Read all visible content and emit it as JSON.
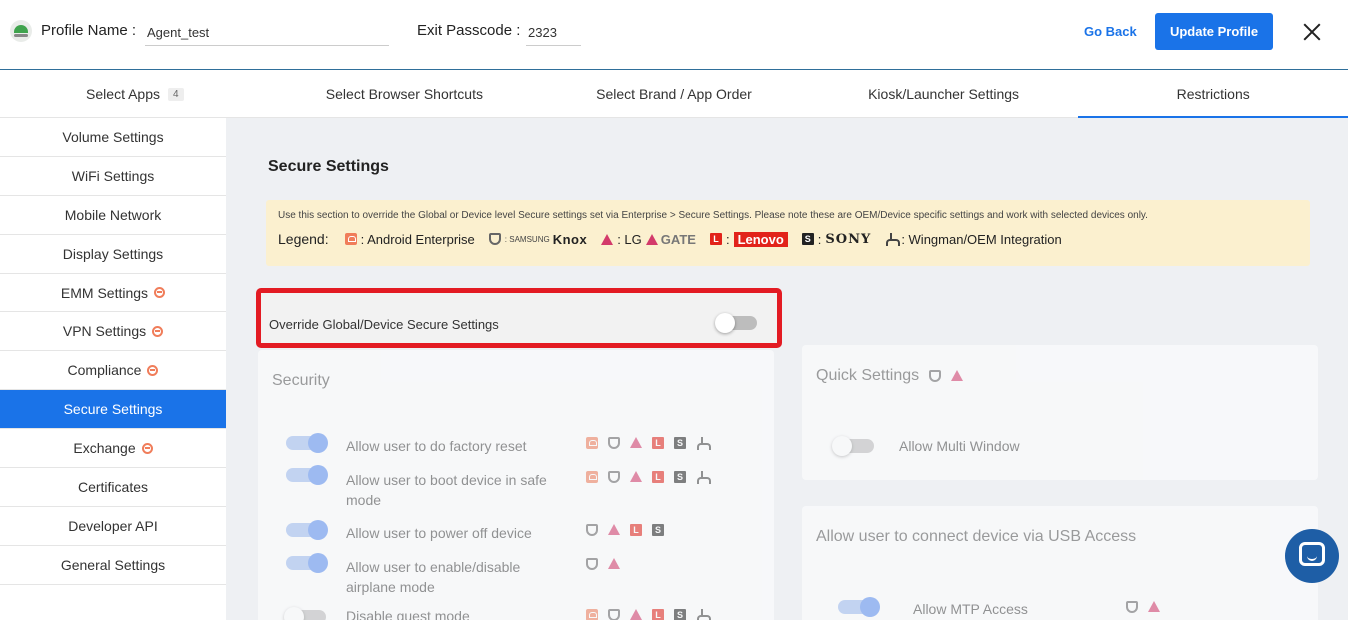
{
  "header": {
    "profile_label": "Profile Name",
    "profile_value": "Agent_test",
    "passcode_label": "Exit Passcode",
    "passcode_value": "2323",
    "go_back": "Go Back",
    "update_button": "Update Profile"
  },
  "tabs": [
    {
      "label": "Select Apps",
      "badge": "4"
    },
    {
      "label": "Select Browser Shortcuts"
    },
    {
      "label": "Select Brand / App Order"
    },
    {
      "label": "Kiosk/Launcher Settings"
    },
    {
      "label": "Restrictions",
      "active": true
    }
  ],
  "sidebar": {
    "items": [
      {
        "label": "Volume Settings"
      },
      {
        "label": "WiFi Settings"
      },
      {
        "label": "Mobile Network"
      },
      {
        "label": "Display Settings"
      },
      {
        "label": "EMM Settings",
        "icon": "android-enterprise-icon"
      },
      {
        "label": "VPN Settings",
        "icon": "android-enterprise-icon"
      },
      {
        "label": "Compliance",
        "icon": "android-enterprise-icon"
      },
      {
        "label": "Secure Settings",
        "active": true
      },
      {
        "label": "Exchange",
        "icon": "android-enterprise-icon"
      },
      {
        "label": "Certificates"
      },
      {
        "label": "Developer API"
      },
      {
        "label": "General Settings"
      }
    ]
  },
  "main": {
    "title": "Secure Settings",
    "notice": "Use this section to override the Global or Device level Secure settings set via Enterprise > Secure Settings. Please note these are OEM/Device specific settings and work with selected devices only.",
    "legend": {
      "label": "Legend:",
      "android_enterprise": ": Android Enterprise",
      "knox": "Knox",
      "knox_prefix": ": SAMSUNG",
      "lg": ": LG",
      "lg_gate": "GATE",
      "lenovo": "Lenovo",
      "lenovo_prefix": ":",
      "sony": "SONY",
      "sony_prefix": ":",
      "wingman": ": Wingman/OEM Integration"
    },
    "override_label": "Override Global/Device Secure Settings",
    "override_enabled": false,
    "security": {
      "title": "Security",
      "rows": [
        {
          "label": "Allow user to do factory reset",
          "on": true
        },
        {
          "label": "Allow user to boot device in safe mode",
          "on": true
        },
        {
          "label": "Allow user to power off device",
          "on": true
        },
        {
          "label": "Allow user to enable/disable airplane mode",
          "on": true
        },
        {
          "label": "Disable guest mode",
          "on": false
        }
      ]
    },
    "quick_settings": {
      "title": "Quick Settings",
      "rows": [
        {
          "label": "Allow Multi Window",
          "on": false
        }
      ]
    },
    "usb": {
      "title": "Allow user to connect device via USB Access",
      "rows": [
        {
          "label": "Allow MTP Access",
          "on": true
        }
      ]
    }
  },
  "colors": {
    "accent": "#1a73e8",
    "highlight_border": "#e31b23",
    "notice_bg": "#fbf0cf",
    "android_enterprise": "#f07d5a"
  }
}
